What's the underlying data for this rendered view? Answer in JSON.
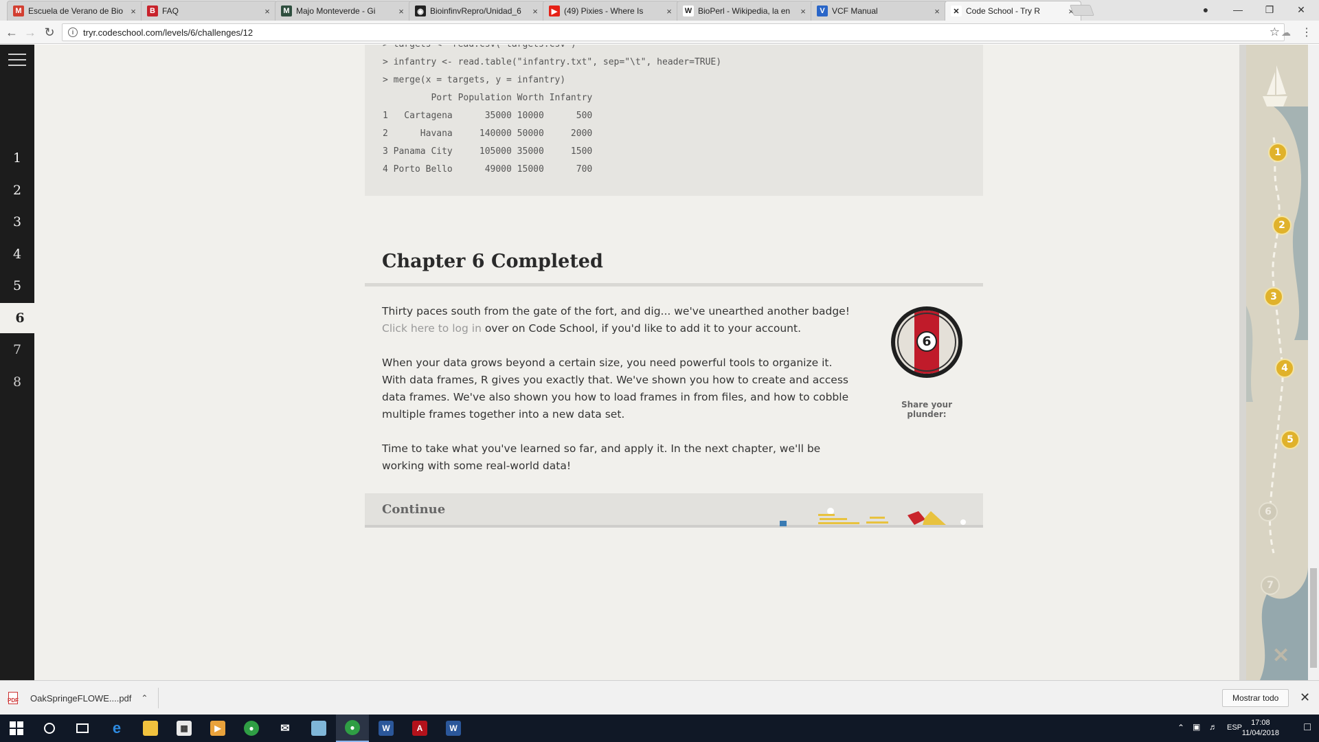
{
  "browser": {
    "tabs": [
      {
        "title": "Escuela de Verano de Bio",
        "icon": "gmail-icon",
        "color": "#d23f31",
        "glyph": "M"
      },
      {
        "title": "FAQ",
        "icon": "bitbucket-icon",
        "color": "#c8232c",
        "glyph": "B"
      },
      {
        "title": "Majo Monteverde - Gi",
        "icon": "site-icon",
        "color": "#2f4f3f",
        "glyph": "M"
      },
      {
        "title": "BioinfinvRepro/Unidad_6",
        "icon": "github-icon",
        "color": "#222222",
        "glyph": "◉"
      },
      {
        "title": "(49) Pixies - Where Is",
        "icon": "youtube-icon",
        "color": "#e62117",
        "glyph": "▶"
      },
      {
        "title": "BioPerl - Wikipedia, la en",
        "icon": "wikipedia-icon",
        "color": "#ffffff",
        "glyph": "W"
      },
      {
        "title": "VCF Manual",
        "icon": "vcf-icon",
        "color": "#2a66c8",
        "glyph": "V"
      },
      {
        "title": "Code School - Try R",
        "icon": "codeschool-icon",
        "color": "#ffffff",
        "glyph": "✕"
      }
    ],
    "url": "tryr.codeschool.com/levels/6/challenges/12"
  },
  "sidebar": {
    "chapters": [
      "1",
      "2",
      "3",
      "4",
      "5",
      "6",
      "7",
      "8"
    ],
    "current": "6"
  },
  "console": {
    "lines": [
      "> targets <- read.csv(\"targets.csv\")",
      "> infantry <- read.table(\"infantry.txt\", sep=\"\\t\", header=TRUE)",
      "> merge(x = targets, y = infantry)",
      "         Port Population Worth Infantry",
      "1   Cartagena      35000 10000      500",
      "2      Havana     140000 50000     2000",
      "3 Panama City     105000 35000     1500",
      "4 Porto Bello      49000 15000      700"
    ]
  },
  "chapter": {
    "title": "Chapter 6 Completed",
    "p1_before": "Thirty paces south from the gate of the fort, and dig... we've unearthed another badge! ",
    "p1_link": "Click here to log in",
    "p1_after": " over on Code School, if you'd like to add it to your account.",
    "p2": "When your data grows beyond a certain size, you need powerful tools to organize it. With data frames, R gives you exactly that. We've shown you how to create and access data frames. We've also shown you how to load frames in from files, and how to cobble multiple frames together into a new data set.",
    "p3": "Time to take what you've learned so far, and apply it. In the next chapter, we'll be working with some real-world data!",
    "badge_number": "6",
    "share_label": "Share your plunder:",
    "continue_label": "Continue"
  },
  "map": {
    "nodes": [
      "1",
      "2",
      "3",
      "4",
      "5",
      "6",
      "7"
    ],
    "completed_count": 5
  },
  "downloads": {
    "file": "OakSpringeFLOWE....pdf",
    "show_all": "Mostrar todo"
  },
  "taskbar": {
    "time": "17:08",
    "date": "11/04/2018",
    "lang": "ESP"
  }
}
